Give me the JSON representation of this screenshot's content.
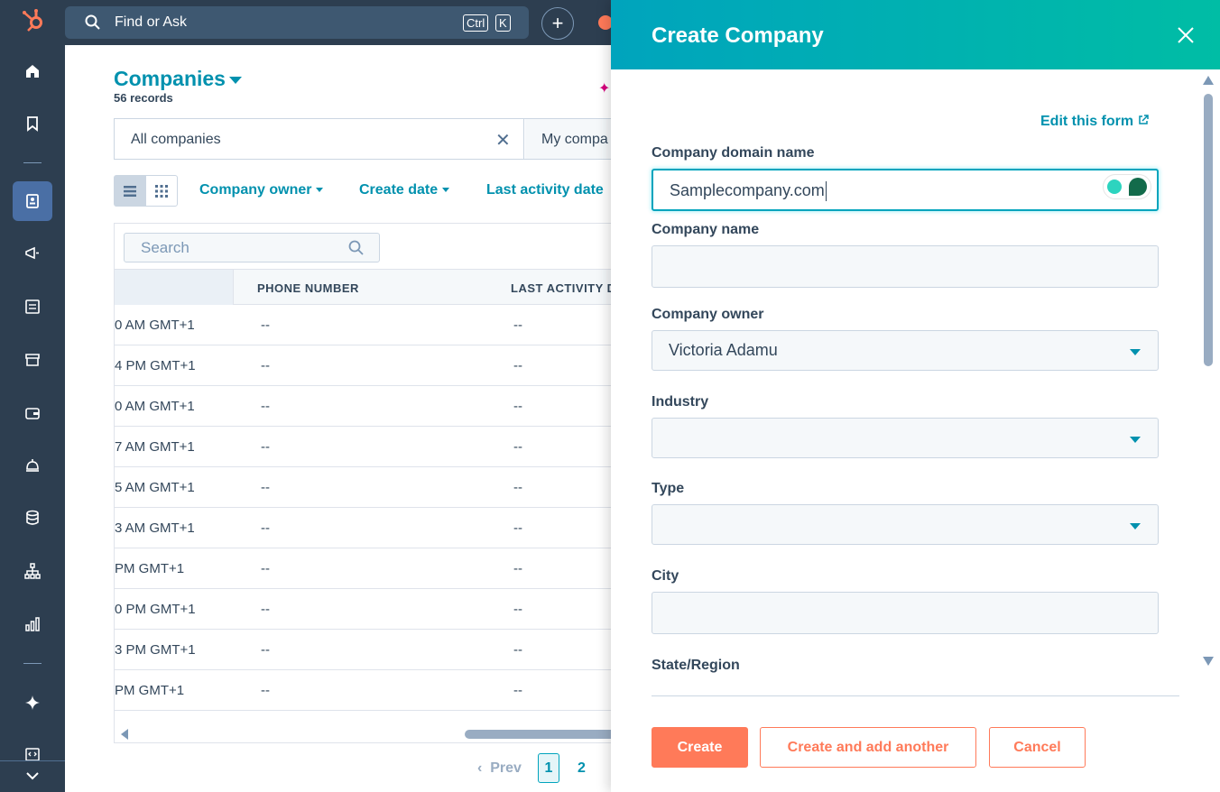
{
  "topbar": {
    "search_placeholder": "Find or Ask",
    "kbd_ctrl": "Ctrl",
    "kbd_k": "K",
    "plus_label": "+"
  },
  "nav": {
    "icons": [
      "home-icon",
      "bookmark-icon",
      "contacts-icon",
      "megaphone-icon",
      "content-icon",
      "commerce-icon",
      "wallet-icon",
      "service-bell-icon",
      "database-icon",
      "org-chart-icon",
      "reporting-icon",
      "ai-sparkle-icon",
      "developer-icon",
      "collapse-icon"
    ]
  },
  "main": {
    "title": "Companies",
    "records": "56 records",
    "tabs": [
      {
        "label": "All companies"
      },
      {
        "label": "My compa"
      }
    ],
    "filters": [
      {
        "label": "Company owner"
      },
      {
        "label": "Create date"
      },
      {
        "label": "Last activity date"
      }
    ],
    "table_search_placeholder": "Search",
    "columns": [
      "PHONE NUMBER",
      "LAST ACTIVITY D"
    ],
    "rows": [
      {
        "c1": "0 AM GMT+1",
        "phone": "--",
        "last": "--"
      },
      {
        "c1": "4 PM GMT+1",
        "phone": "--",
        "last": "--"
      },
      {
        "c1": "0 AM GMT+1",
        "phone": "--",
        "last": "--"
      },
      {
        "c1": "7 AM GMT+1",
        "phone": "--",
        "last": "--"
      },
      {
        "c1": "5 AM GMT+1",
        "phone": "--",
        "last": "--"
      },
      {
        "c1": "3 AM GMT+1",
        "phone": "--",
        "last": "--"
      },
      {
        "c1": " PM GMT+1",
        "phone": "--",
        "last": "--"
      },
      {
        "c1": "0 PM GMT+1",
        "phone": "--",
        "last": "--"
      },
      {
        "c1": "3 PM GMT+1",
        "phone": "--",
        "last": "--"
      },
      {
        "c1": " PM GMT+1",
        "phone": "--",
        "last": "--"
      }
    ],
    "pager": {
      "prev": "Prev",
      "page1": "1",
      "page2": "2"
    }
  },
  "panel": {
    "title": "Create Company",
    "edit_form": "Edit this form",
    "fields": {
      "domain": {
        "label": "Company domain name",
        "value": "Samplecompany.com"
      },
      "name": {
        "label": "Company name",
        "value": ""
      },
      "owner": {
        "label": "Company owner",
        "value": "Victoria Adamu"
      },
      "industry": {
        "label": "Industry",
        "value": ""
      },
      "type": {
        "label": "Type",
        "value": ""
      },
      "city": {
        "label": "City",
        "value": ""
      },
      "state": {
        "label": "State/Region"
      }
    },
    "buttons": {
      "create": "Create",
      "create_another": "Create and add another",
      "cancel": "Cancel"
    }
  },
  "colors": {
    "nav_bg": "#2d3e50",
    "accent_teal": "#0091ae",
    "header_gradient_start": "#00a4bd",
    "header_gradient_end": "#00bda5",
    "primary_button": "#ff7a59"
  }
}
